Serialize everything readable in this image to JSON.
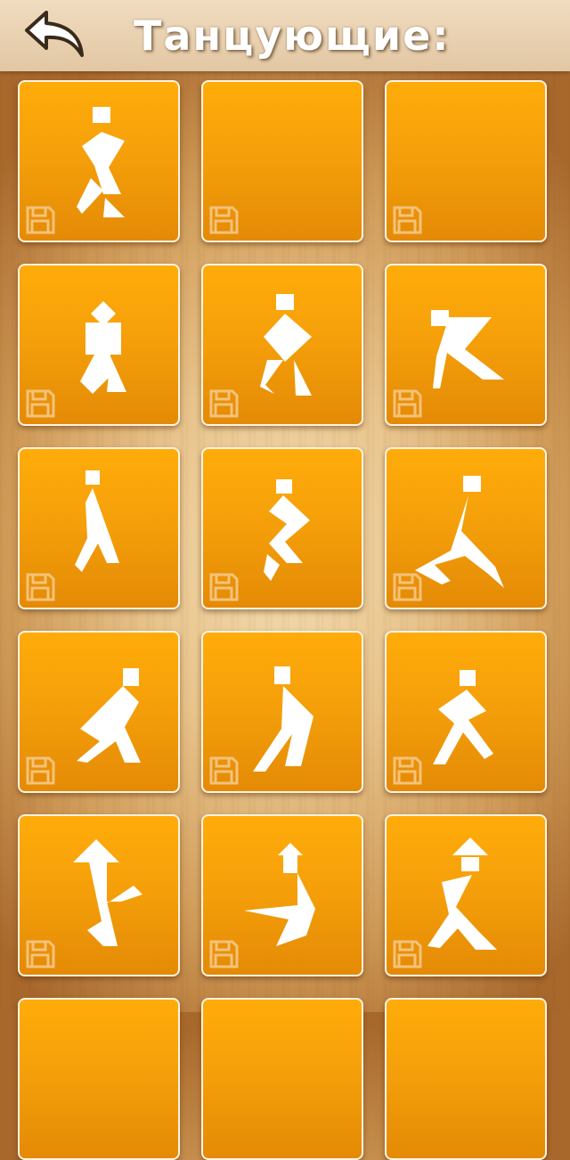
{
  "header": {
    "title": "Танцующие:",
    "back_icon": "back-arrow-icon"
  },
  "colors": {
    "tile_top": "#ffac0a",
    "tile_bottom": "#e48a06",
    "tile_border": "#fff3e2",
    "figure": "#ffffff",
    "save_icon": "#f4c27a"
  },
  "tiles": [
    {
      "id": 1,
      "saved": false
    },
    {
      "id": 2,
      "saved": false
    },
    {
      "id": 3,
      "saved": false
    },
    {
      "id": 4,
      "saved": false
    },
    {
      "id": 5,
      "saved": false
    },
    {
      "id": 6,
      "saved": false
    },
    {
      "id": 7,
      "saved": false
    },
    {
      "id": 8,
      "saved": false
    },
    {
      "id": 9,
      "saved": false
    },
    {
      "id": 10,
      "saved": false
    },
    {
      "id": 11,
      "saved": false
    },
    {
      "id": 12,
      "saved": false
    },
    {
      "id": 13,
      "saved": false
    },
    {
      "id": 14,
      "saved": false
    },
    {
      "id": 15,
      "saved": false
    },
    {
      "id": 16,
      "saved": false
    },
    {
      "id": 17,
      "saved": false
    },
    {
      "id": 18,
      "saved": false
    }
  ]
}
